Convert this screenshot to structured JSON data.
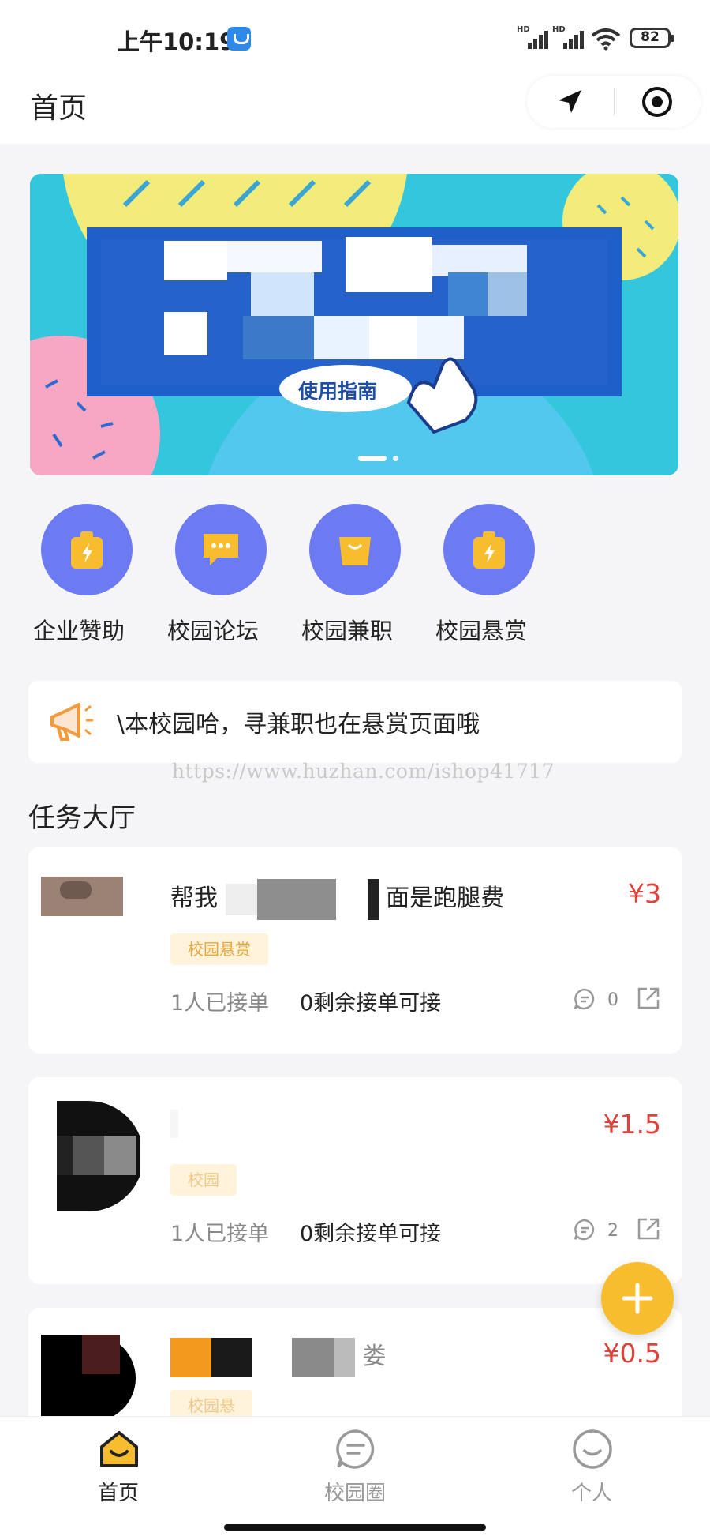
{
  "status_bar": {
    "time": "上午10:19",
    "battery": "82",
    "signal_1_label": "HD",
    "signal_2_label": "HD"
  },
  "header": {
    "title": "首页"
  },
  "banner": {
    "caption": "使用指南",
    "page_count": 2,
    "active_page": 1
  },
  "quick_links": [
    {
      "label": "企业赞助",
      "icon": "lightning-bag-icon"
    },
    {
      "label": "校园论坛",
      "icon": "chat-bubble-icon"
    },
    {
      "label": "校园兼职",
      "icon": "shopping-bag-icon"
    },
    {
      "label": "校园悬赏",
      "icon": "lightning-bag-icon"
    }
  ],
  "notice": {
    "text": "\\本校园哈，寻兼职也在悬赏页面哦",
    "icon": "megaphone-icon"
  },
  "watermark": "https://www.huzhan.com/ishop41717",
  "section_title": "任务大厅",
  "tasks": [
    {
      "title_prefix": "帮我",
      "title_suffix": "面是跑腿费",
      "price": "¥3",
      "tag": "校园悬赏",
      "accepted": "1人已接单",
      "remaining": "0剩余接单可接",
      "comments": "0"
    },
    {
      "title_prefix": "",
      "title_suffix": "",
      "price": "¥1.5",
      "tag": "校园",
      "accepted": "1人已接单",
      "remaining": "0剩余接单可接",
      "comments": "2"
    },
    {
      "title_prefix": "",
      "title_suffix": "娄",
      "price": "¥0.5",
      "tag": "校园悬",
      "accepted": "",
      "remaining": "",
      "comments": ""
    }
  ],
  "tabbar": [
    {
      "label": "首页",
      "active": true
    },
    {
      "label": "校园圈",
      "active": false
    },
    {
      "label": "个人",
      "active": false
    }
  ],
  "colors": {
    "accent": "#6c7bf1",
    "price": "#e0423a",
    "fab": "#f7bd2e",
    "tag_bg": "#fff3dc",
    "tag_text": "#e8a53a"
  }
}
